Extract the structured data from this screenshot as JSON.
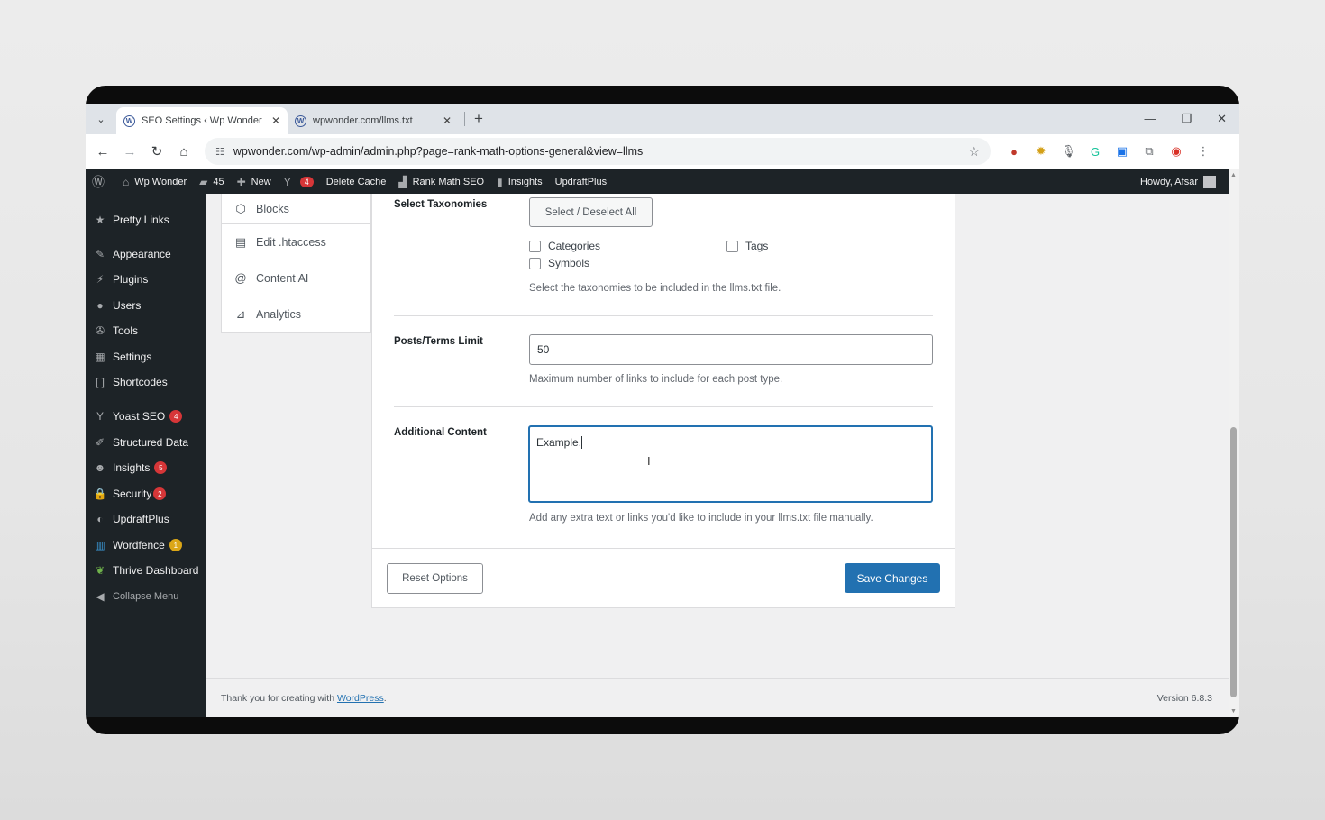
{
  "browser": {
    "tabs": [
      {
        "title": "SEO Settings ‹ Wp Wonder — \\",
        "active": true
      },
      {
        "title": "wpwonder.com/llms.txt",
        "active": false
      }
    ],
    "url": "wpwonder.com/wp-admin/admin.php?page=rank-math-options-general&view=llms",
    "extensions": [
      "rank-math-ext-icon",
      "gear-ext-icon",
      "mic-icon",
      "grammarly-icon",
      "screenshot-ext-icon",
      "puzzle-icon",
      "profile-avatar",
      "kebab-menu-icon"
    ]
  },
  "adminbar": {
    "site_name": "Wp Wonder",
    "comments_count": "45",
    "new_label": "New",
    "yoast_count": "4",
    "delete_cache": "Delete Cache",
    "rank_math": "Rank Math SEO",
    "insights": "Insights",
    "updraft": "UpdraftPlus",
    "howdy": "Howdy, Afsar"
  },
  "sidebar": {
    "items": [
      {
        "label": "Pretty Links",
        "icon": "star-link-icon"
      },
      {
        "label": "Appearance",
        "icon": "paintbrush-icon"
      },
      {
        "label": "Plugins",
        "icon": "plug-icon"
      },
      {
        "label": "Users",
        "icon": "user-icon"
      },
      {
        "label": "Tools",
        "icon": "wrench-icon"
      },
      {
        "label": "Settings",
        "icon": "sliders-icon"
      },
      {
        "label": "Shortcodes",
        "icon": "brackets-icon"
      },
      {
        "label": "Yoast SEO",
        "icon": "yoast-icon",
        "count": "4"
      },
      {
        "label": "Structured Data",
        "icon": "pin-icon"
      },
      {
        "label": "Insights",
        "icon": "insights-icon",
        "count": "5"
      },
      {
        "label": "Security",
        "icon": "lock-icon",
        "count": "2"
      },
      {
        "label": "UpdraftPlus",
        "icon": "updraft-icon"
      },
      {
        "label": "Wordfence",
        "icon": "wordfence-icon",
        "count": "1"
      },
      {
        "label": "Thrive Dashboard",
        "icon": "leaf-icon"
      },
      {
        "label": "Collapse Menu",
        "icon": "collapse-icon"
      }
    ]
  },
  "subnav": {
    "items": [
      "Blocks",
      "Edit .htaccess",
      "Content AI",
      "Analytics"
    ]
  },
  "form": {
    "taxonomies": {
      "label": "Select Taxonomies",
      "select_all": "Select / Deselect All",
      "options": [
        "Categories",
        "Tags",
        "Symbols"
      ],
      "description": "Select the taxonomies to be included in the llms.txt file."
    },
    "limit": {
      "label": "Posts/Terms Limit",
      "value": "50",
      "description": "Maximum number of links to include for each post type."
    },
    "additional": {
      "label": "Additional Content",
      "value": "Example.",
      "description": "Add any extra text or links you'd like to include in your llms.txt file manually."
    },
    "reset_label": "Reset Options",
    "save_label": "Save Changes"
  },
  "footer": {
    "thanks": "Thank you for creating with ",
    "link": "WordPress",
    "period": ".",
    "version": "Version 6.8.3"
  }
}
